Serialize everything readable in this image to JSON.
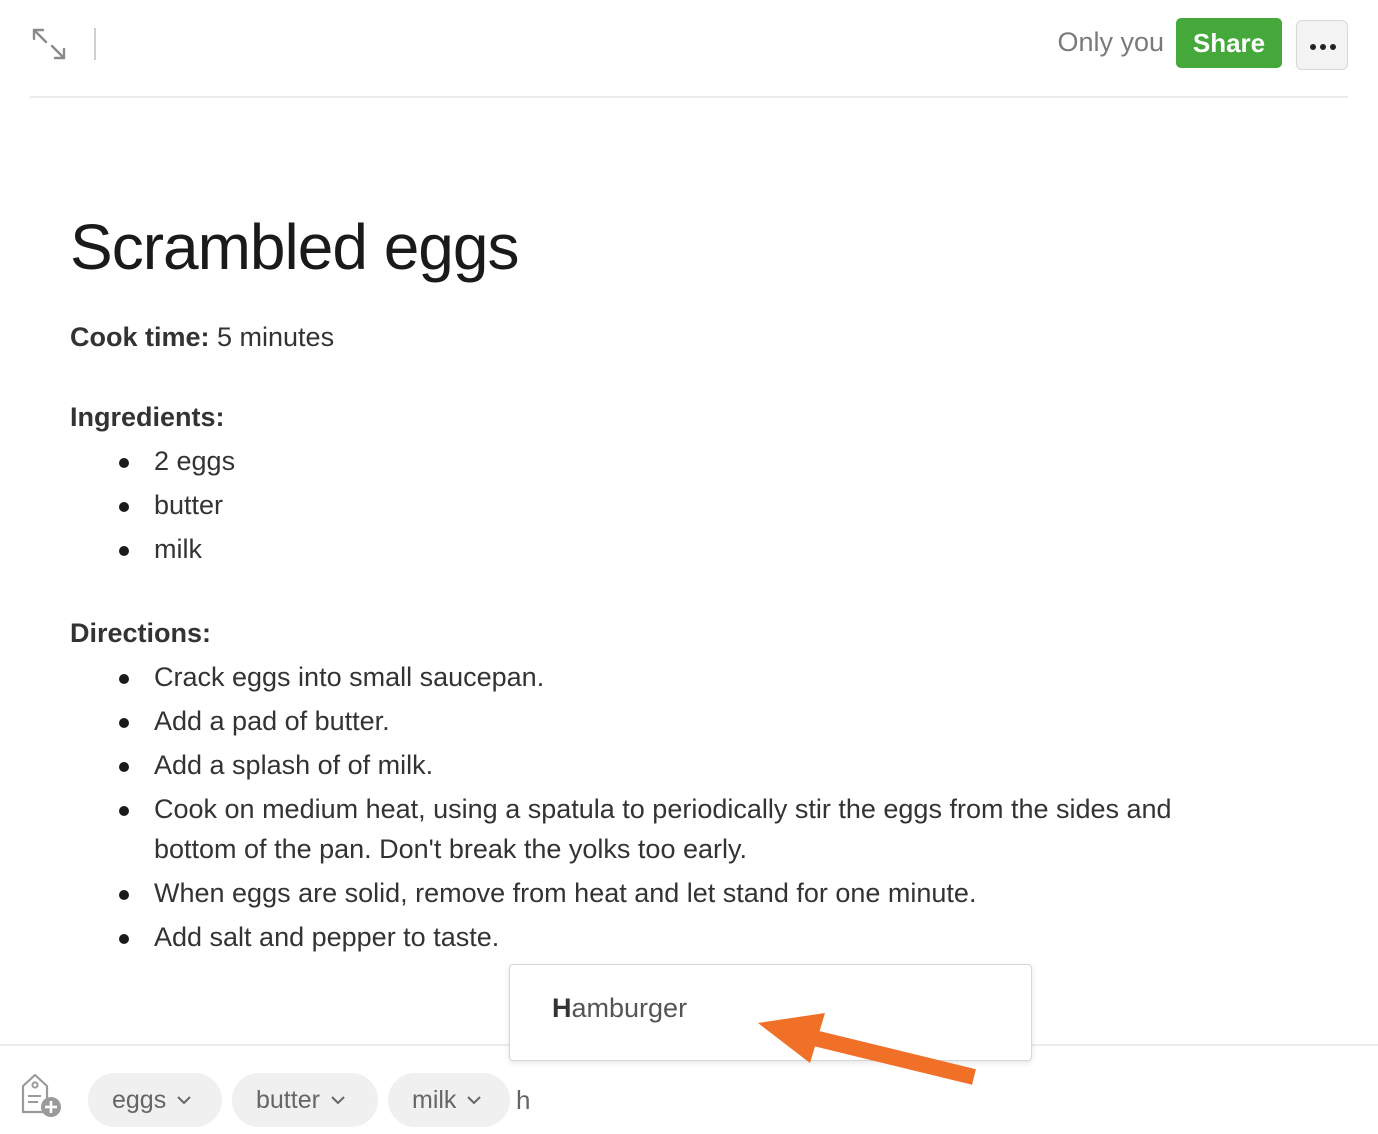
{
  "header": {
    "expand_icon": "expand-arrows-icon",
    "visibility": "Only you",
    "share_label": "Share",
    "more_icon": "ellipsis-icon",
    "share_color": "#44a83a"
  },
  "note": {
    "title": "Scrambled eggs",
    "cook_time_label": "Cook time:",
    "cook_time_value": " 5 minutes",
    "ingredients_heading": "Ingredients:",
    "ingredients": [
      "2 eggs",
      "butter",
      "milk"
    ],
    "directions_heading": "Directions:",
    "directions": [
      "Crack eggs into small saucepan.",
      "Add a pad of butter.",
      "Add a splash of of milk.",
      "Cook on medium heat, using a spatula to periodically stir the eggs from the sides and",
      "bottom of the pan. Don't break the yolks too early.",
      "When eggs are solid, remove from heat and let stand for one minute.",
      "Add salt and pepper to taste."
    ]
  },
  "tags": {
    "add_icon": "tag-add-icon",
    "items": [
      "eggs",
      "butter",
      "milk"
    ],
    "input_value": "h"
  },
  "autocomplete": {
    "match": "H",
    "rest": "amburger"
  },
  "annotation": {
    "arrow_color": "#f07028"
  }
}
